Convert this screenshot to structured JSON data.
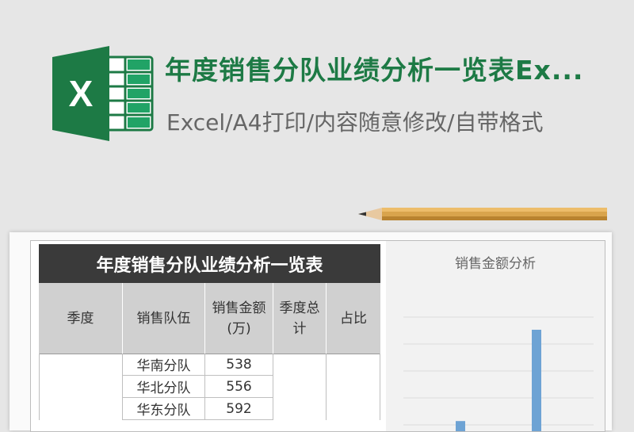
{
  "header": {
    "title": "年度销售分队业绩分析一览表Ex...",
    "subtitle": "Excel/A4打印/内容随意修改/自带格式",
    "logo_letter": "X"
  },
  "colors": {
    "excel_green": "#1d7a45",
    "header_dark": "#3a3a3a",
    "header_gray": "#d0d0d0",
    "bar_blue": "#6ea3d4"
  },
  "table": {
    "title": "年度销售分队业绩分析一览表",
    "headers": [
      "季度",
      "销售队伍",
      "销售金额\n(万)",
      "季度总\n计",
      "占比"
    ],
    "rows": [
      {
        "quarter": "",
        "team": "华南分队",
        "amount": "538",
        "total": "",
        "ratio": ""
      },
      {
        "quarter": "",
        "team": "华北分队",
        "amount": "556",
        "total": "",
        "ratio": ""
      },
      {
        "quarter": "",
        "team": "华东分队",
        "amount": "592",
        "total": "",
        "ratio": ""
      }
    ]
  },
  "chart_data": {
    "type": "bar",
    "title": "销售金额分析",
    "grid": true,
    "bars": [
      {
        "x": 2,
        "value": 0.1
      },
      {
        "x": 4,
        "value": 1.0
      }
    ]
  },
  "icons": {
    "logo": "excel-logo-icon",
    "pencil": "pencil-icon"
  }
}
